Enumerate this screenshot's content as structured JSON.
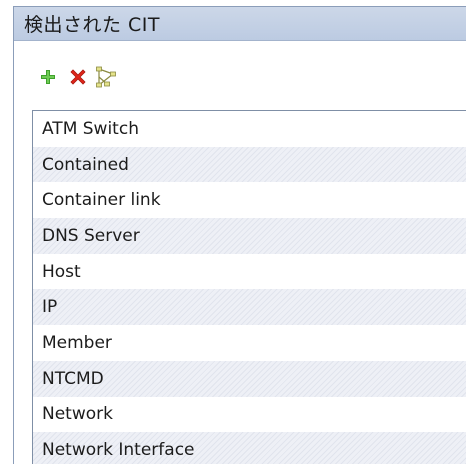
{
  "panel": {
    "title": "検出された CIT"
  },
  "toolbar": {
    "icons": [
      "add-icon",
      "delete-icon",
      "hierarchy-icon"
    ],
    "colors": {
      "add": "#3fa12c",
      "delete": "#e0261b"
    }
  },
  "list": {
    "items": [
      "ATM Switch",
      "Contained",
      "Container link",
      "DNS Server",
      "Host",
      "IP",
      "Member",
      "NTCMD",
      "Network",
      "Network Interface"
    ]
  }
}
